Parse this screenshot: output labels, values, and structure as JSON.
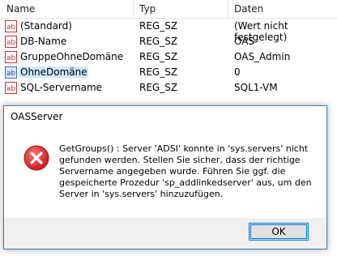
{
  "columns": {
    "name": "Name",
    "type": "Typ",
    "data": "Daten"
  },
  "rows": [
    {
      "name": "(Standard)",
      "type": "REG_SZ",
      "data": "(Wert nicht festgelegt)",
      "icon": "string-value-icon"
    },
    {
      "name": "DB-Name",
      "type": "REG_SZ",
      "data": "OAS",
      "icon": "string-value-icon"
    },
    {
      "name": "GruppeOhneDomäne",
      "type": "REG_SZ",
      "data": "OAS_Admin",
      "icon": "string-value-icon"
    },
    {
      "name": "OhneDomäne",
      "type": "REG_SZ",
      "data": "0",
      "icon": "string-value-icon",
      "selected": true
    },
    {
      "name": "SQL-Servername",
      "type": "REG_SZ",
      "data": "SQL1-VM",
      "icon": "string-value-icon"
    }
  ],
  "dialog": {
    "title": "OASServer",
    "icon": "error-icon",
    "message": "GetGroups() : Server 'ADSI' konnte in 'sys.servers' nicht gefunden werden. Stellen Sie sicher, dass der richtige Servername angegeben wurde. Führen Sie ggf. die gespeicherte Prozedur 'sp_addlinkedserver' aus, um den Server in 'sys.servers' hinzuzufügen.",
    "ok_label": "OK"
  },
  "colors": {
    "selection": "#cce8ff",
    "error_red": "#e81123",
    "accent": "#0078d7"
  }
}
